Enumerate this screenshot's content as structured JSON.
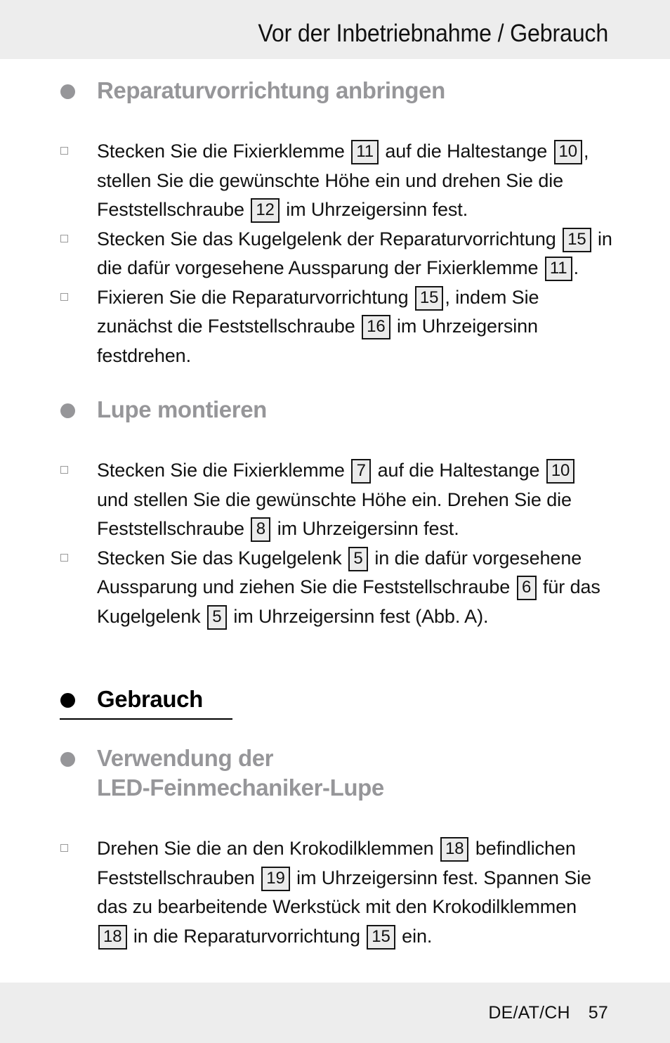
{
  "header": {
    "title": "Vor der Inbetriebnahme / Gebrauch",
    "background_color": "#ededed"
  },
  "colors": {
    "heading_gray": "#969699",
    "heading_black": "#000000",
    "body_text": "#121212",
    "ref_box_fill": "#ebebeb",
    "ref_box_border": "#151515",
    "band_background": "#ededed",
    "page_background": "#ffffff"
  },
  "sections": [
    {
      "id": "reparaturvorrichtung-anbringen",
      "heading": "Reparaturvorrichtung anbringen",
      "heading_style": "gray",
      "bullet": "filled-circle",
      "underlined": false,
      "items": [
        {
          "parts": [
            {
              "t": "text",
              "v": "Stecken Sie die Fixierklemme "
            },
            {
              "t": "ref",
              "v": "11"
            },
            {
              "t": "text",
              "v": " auf die Haltestange "
            },
            {
              "t": "ref",
              "v": "10"
            },
            {
              "t": "text",
              "v": ", stellen Sie die gewünschte Höhe ein und drehen Sie die Feststellschraube "
            },
            {
              "t": "ref",
              "v": "12"
            },
            {
              "t": "text",
              "v": " im Uhrzeigersinn fest."
            }
          ]
        },
        {
          "parts": [
            {
              "t": "text",
              "v": "Stecken Sie das Kugelgelenk der Reparaturvorrichtung "
            },
            {
              "t": "ref",
              "v": "15"
            },
            {
              "t": "text",
              "v": " in die dafür vorgesehene Aussparung der Fixierklemme "
            },
            {
              "t": "ref",
              "v": "11"
            },
            {
              "t": "text",
              "v": "."
            }
          ]
        },
        {
          "parts": [
            {
              "t": "text",
              "v": "Fixieren Sie die Reparaturvorrichtung "
            },
            {
              "t": "ref",
              "v": "15"
            },
            {
              "t": "text",
              "v": ", indem Sie zunächst die Feststellschraube "
            },
            {
              "t": "ref",
              "v": "16"
            },
            {
              "t": "text",
              "v": " im Uhrzeigersinn festdrehen."
            }
          ]
        }
      ]
    },
    {
      "id": "lupe-montieren",
      "heading": "Lupe montieren",
      "heading_style": "gray",
      "bullet": "filled-circle",
      "underlined": false,
      "items": [
        {
          "parts": [
            {
              "t": "text",
              "v": "Stecken Sie die Fixierklemme "
            },
            {
              "t": "ref",
              "v": "7"
            },
            {
              "t": "text",
              "v": " auf die Haltestange "
            },
            {
              "t": "ref",
              "v": "10"
            },
            {
              "t": "text",
              "v": " und stellen Sie die gewünschte Höhe ein. Drehen Sie die Feststellschraube "
            },
            {
              "t": "ref",
              "v": "8"
            },
            {
              "t": "text",
              "v": " im Uhrzeigersinn fest."
            }
          ]
        },
        {
          "parts": [
            {
              "t": "text",
              "v": "Stecken Sie das Kugelgelenk "
            },
            {
              "t": "ref",
              "v": "5"
            },
            {
              "t": "text",
              "v": " in die dafür vorgesehene Aussparung und ziehen Sie die Feststellschraube "
            },
            {
              "t": "ref",
              "v": "6"
            },
            {
              "t": "text",
              "v": " für das Kugelgelenk "
            },
            {
              "t": "ref",
              "v": "5"
            },
            {
              "t": "text",
              "v": " im Uhrzeigersinn fest (Abb. A)."
            }
          ]
        }
      ]
    },
    {
      "id": "gebrauch",
      "heading": "Gebrauch",
      "heading_style": "black",
      "bullet": "filled-circle",
      "underlined": true,
      "items": []
    },
    {
      "id": "verwendung-der-led-feinmechaniker-lupe",
      "heading_line1": "Verwendung der",
      "heading_line2": "LED-Feinmechaniker-Lupe",
      "heading_style": "gray",
      "bullet": "filled-circle",
      "underlined": false,
      "items": [
        {
          "parts": [
            {
              "t": "text",
              "v": "Drehen Sie die an den Krokodilklemmen "
            },
            {
              "t": "ref",
              "v": "18"
            },
            {
              "t": "text",
              "v": " befindlichen Feststellschrauben "
            },
            {
              "t": "ref",
              "v": "19"
            },
            {
              "t": "text",
              "v": " im Uhrzeigersinn fest. Spannen Sie das zu bearbeitende Werkstück mit den Krokodilklemmen "
            },
            {
              "t": "ref",
              "v": "18"
            },
            {
              "t": "text",
              "v": " in die Reparaturvorrichtung "
            },
            {
              "t": "ref",
              "v": "15"
            },
            {
              "t": "text",
              "v": " ein."
            }
          ]
        }
      ]
    }
  ],
  "footer": {
    "locale": "DE/AT/CH",
    "page_number": "57"
  }
}
